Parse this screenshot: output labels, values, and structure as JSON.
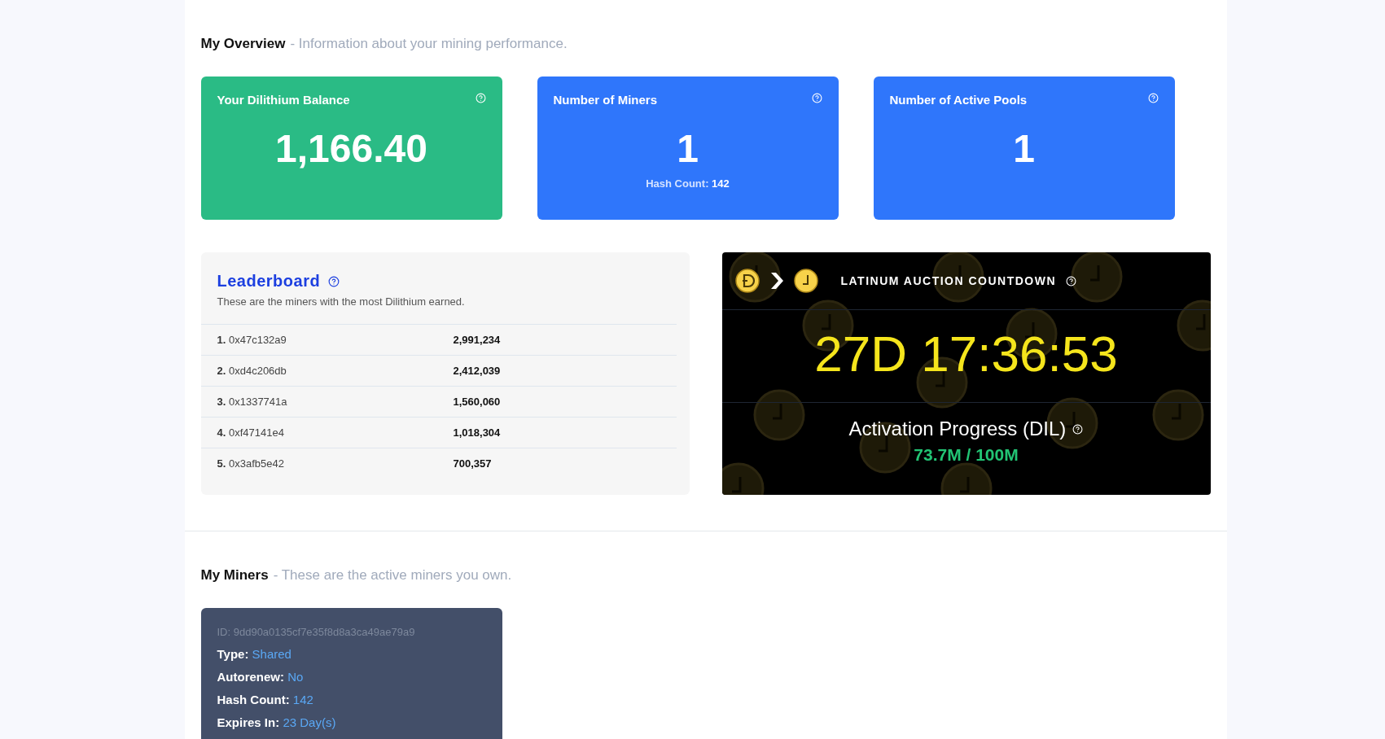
{
  "overview": {
    "title": "My Overview",
    "subtitle": "- Information about your mining performance."
  },
  "stat_cards": [
    {
      "title": "Your Dilithium Balance",
      "value": "1,166.40",
      "color": "#2abb85"
    },
    {
      "title": "Number of Miners",
      "value": "1",
      "note": "Hash Count: **142**",
      "color": "#2f76fb"
    },
    {
      "title": "Number of Active Pools",
      "value": "1",
      "color": "#2f76fb"
    }
  ],
  "leaderboard": {
    "title": "Leaderboard",
    "subtitle": "These are the miners with the most Dilithium earned.",
    "rows": [
      {
        "rank": "1.",
        "address": "0x47c132a9",
        "amount": "2,991,234"
      },
      {
        "rank": "2.",
        "address": "0xd4c206db",
        "amount": "2,412,039"
      },
      {
        "rank": "3.",
        "address": "0x1337741a",
        "amount": "1,560,060"
      },
      {
        "rank": "4.",
        "address": "0xf47141e4",
        "amount": "1,018,304"
      },
      {
        "rank": "5.",
        "address": "0x3afb5e42",
        "amount": "700,357"
      }
    ]
  },
  "countdown": {
    "title": "LATINUM AUCTION COUNTDOWN",
    "timer": "27D 17:36:53",
    "progress_label": "Activation Progress (DIL)",
    "progress_value": "73.7M / 100M"
  },
  "miners": {
    "title": "My Miners",
    "subtitle": "- These are the active miners you own.",
    "cards": [
      {
        "id": "ID: 9dd90a0135cf7e35f8d8a3ca49ae79a9",
        "fields": [
          {
            "label": "Type:",
            "value": "Shared"
          },
          {
            "label": "Autorenew:",
            "value": "No"
          },
          {
            "label": "Hash Count:",
            "value": "142"
          },
          {
            "label": "Expires In:",
            "value": "23 Day(s)"
          }
        ]
      }
    ]
  }
}
